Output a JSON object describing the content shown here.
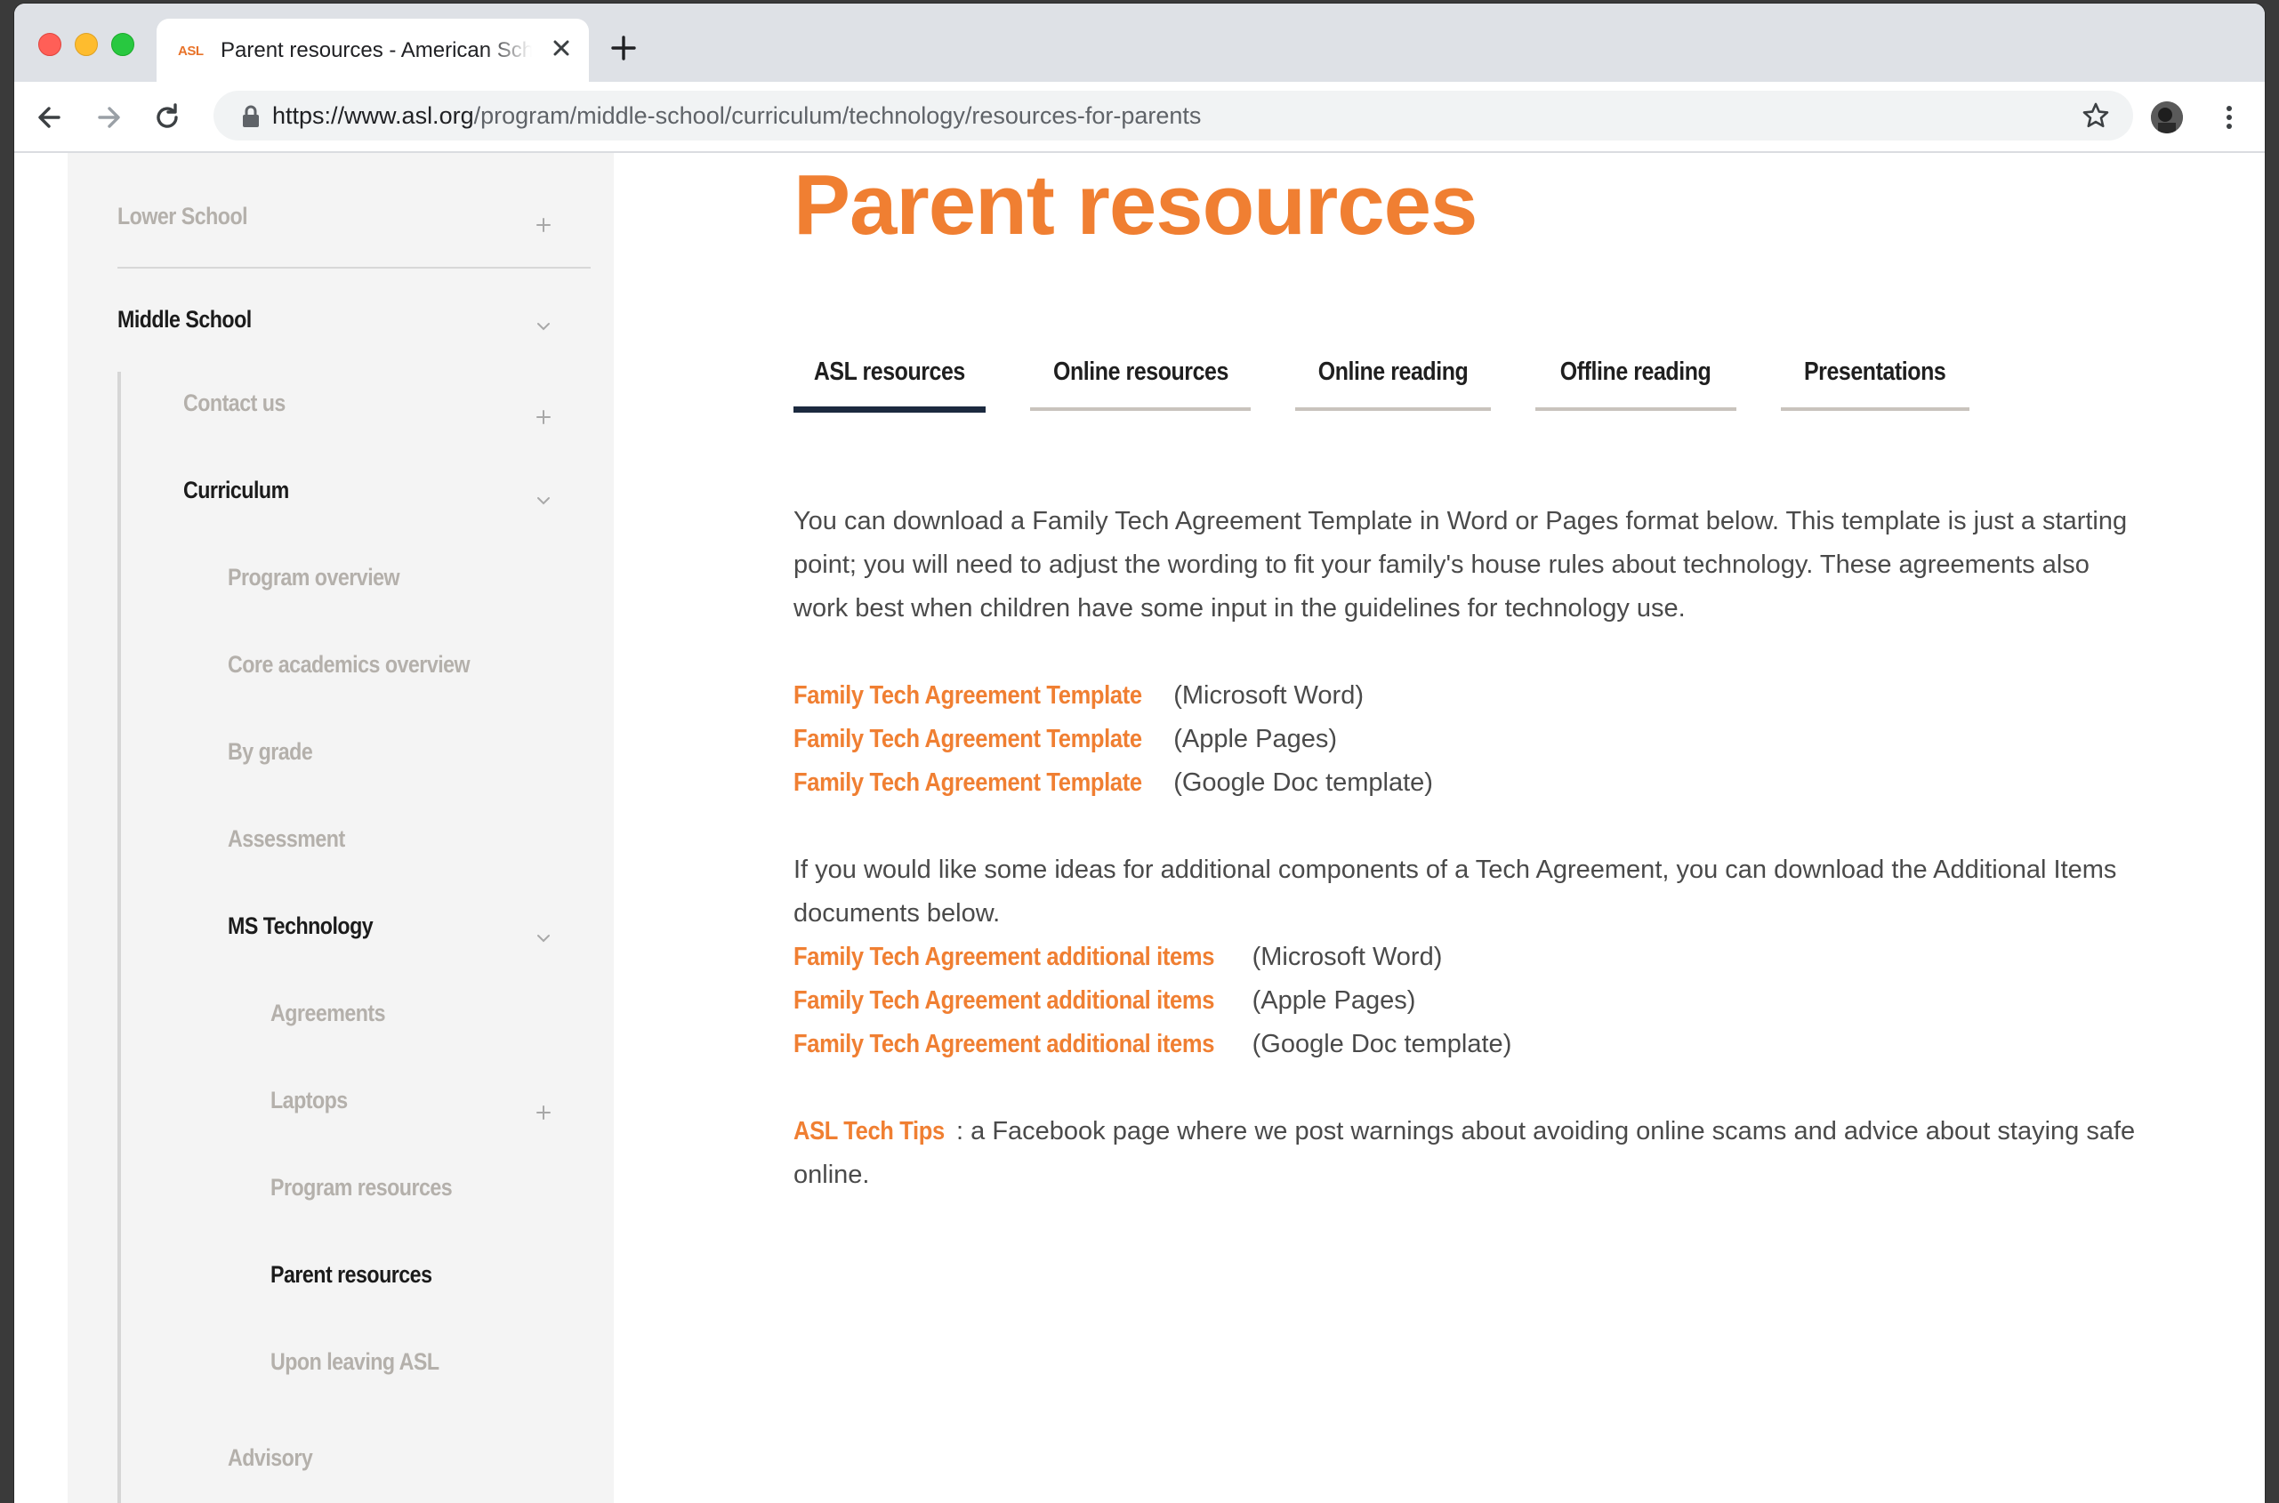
{
  "browser": {
    "tab_favicon": "ASL",
    "tab_title": "Parent resources - American School in London",
    "url_host": "https://www.asl.org",
    "url_path": "/program/middle-school/curriculum/technology/resources-for-parents",
    "icons": {
      "back": "arrow-left-icon",
      "forward": "arrow-right-icon",
      "reload": "reload-icon",
      "lock": "lock-icon",
      "bookmark": "star-icon",
      "menu": "kebab-menu-icon",
      "close_tab": "close-icon",
      "new_tab": "plus-icon"
    }
  },
  "sidebar": {
    "lower_school": "Lower School",
    "middle_school": "Middle School",
    "contact_us": "Contact us",
    "curriculum": "Curriculum",
    "program_overview": "Program overview",
    "core_academics": "Core academics overview",
    "by_grade": "By grade",
    "assessment": "Assessment",
    "ms_technology": "MS Technology",
    "agreements": "Agreements",
    "laptops": "Laptops",
    "program_resources": "Program resources",
    "parent_resources": "Parent resources",
    "upon_leaving": "Upon leaving ASL",
    "advisory": "Advisory"
  },
  "page": {
    "title": "Parent resources",
    "tabs": [
      "ASL resources",
      "Online resources",
      "Online reading",
      "Offline reading",
      "Presentations"
    ],
    "active_tab": "ASL resources",
    "intro_line1": "You can download a Family Tech Agreement Template in Word or Pages format below. This template is just a starting",
    "intro_line2": "point; you will need to adjust the wording to fit your family's house rules about technology. These agreements also",
    "intro_line3": "work best when children have some input in the guidelines for technology use.",
    "template_links": [
      {
        "label": "Family Tech Agreement Template",
        "suffix": " (Microsoft Word)"
      },
      {
        "label": "Family Tech Agreement Template",
        "suffix": " (Apple Pages)"
      },
      {
        "label": "Family Tech Agreement Template",
        "suffix": " (Google Doc template)"
      }
    ],
    "additional_line1": "If you would like some ideas for additional components of a Tech Agreement, you can download the Additional Items",
    "additional_line2": "documents below.",
    "additional_links": [
      {
        "label": "Family Tech Agreement additional items",
        "suffix": " (Microsoft Word)"
      },
      {
        "label": "Family Tech Agreement additional items",
        "suffix": " (Apple Pages)"
      },
      {
        "label": "Family Tech Agreement additional items",
        "suffix": " (Google Doc template)"
      }
    ],
    "tips_link": "ASL Tech Tips",
    "tips_line1": ": a Facebook page where we post warnings about avoiding online scams and advice about staying safe",
    "tips_line2": "online."
  },
  "colors": {
    "accent": "#f07f32",
    "active_tab_bar": "#1c2a3f",
    "sidebar_bg": "#f4f4f4"
  }
}
